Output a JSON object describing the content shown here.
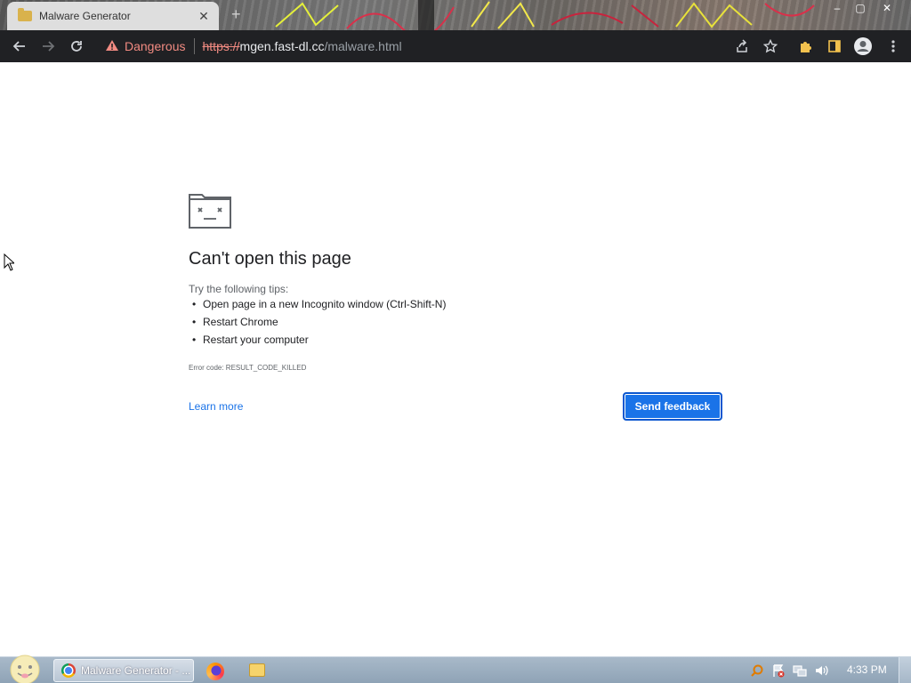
{
  "browser": {
    "tab": {
      "title": "Malware Generator",
      "icon": "folder-icon"
    },
    "window_controls": {
      "minimize": "–",
      "maximize": "▢",
      "close": "✕",
      "new_tab": "+"
    },
    "toolbar": {
      "security_label": "Dangerous",
      "url_scheme": "https://",
      "url_host": "mgen.fast-dl.cc",
      "url_path": "/malware.html",
      "icons": [
        "back-icon",
        "forward-icon",
        "reload-icon",
        "share-icon",
        "star-icon",
        "extensions-icon",
        "side-panel-icon",
        "profile-icon",
        "menu-icon"
      ]
    }
  },
  "error_page": {
    "icon": "sad-folder-icon",
    "heading": "Can't open this page",
    "tips_intro": "Try the following tips:",
    "tips": [
      "Open page in a new Incognito window (Ctrl-Shift-N)",
      "Restart Chrome",
      "Restart your computer"
    ],
    "error_code": "Error code: RESULT_CODE_KILLED",
    "learn_more": "Learn more",
    "send_feedback": "Send feedback"
  },
  "taskbar": {
    "active_task": "Malware Generator - ...",
    "pinned": [
      "firefox-icon",
      "folder-icon"
    ],
    "tray_icons": [
      "search-icon",
      "flag-icon",
      "network-icon",
      "volume-icon"
    ],
    "clock": "4:33 PM"
  },
  "colors": {
    "danger": "#f28b82",
    "accent": "#1a73e8",
    "toolbar_bg": "#202124",
    "taskbar_bg": "#9cafc1"
  }
}
